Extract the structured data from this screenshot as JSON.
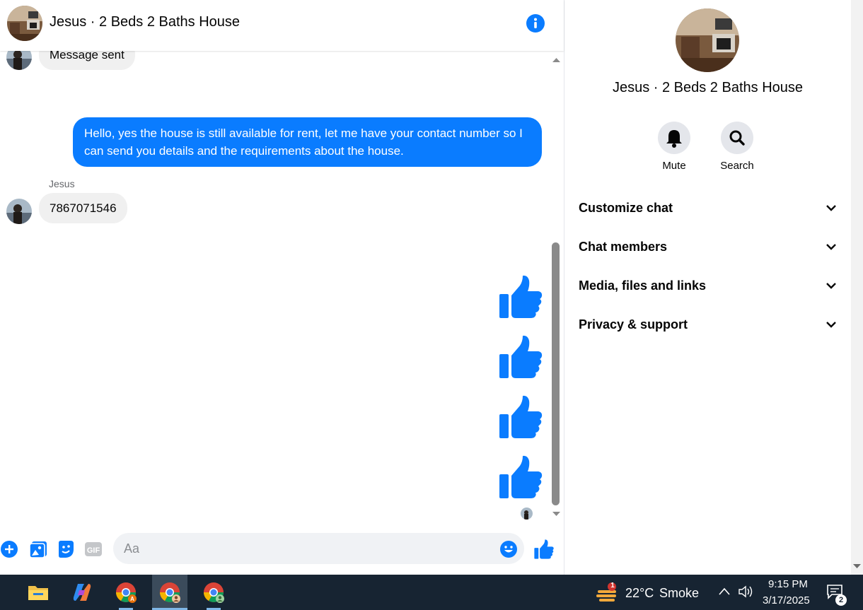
{
  "chat": {
    "title": "Jesus · 2 Beds 2 Baths House",
    "partial_message": "Message sent",
    "outgoing_message": "Hello, yes the house is still available for rent, let me have your contact number so I can send you details and the requirements about the house.",
    "sender_name": "Jesus",
    "incoming_message": "7867071546",
    "like_count": 4
  },
  "composer": {
    "placeholder": "Aa"
  },
  "details": {
    "title": "Jesus · 2 Beds 2 Baths House",
    "actions": [
      {
        "label": "Mute",
        "icon": "bell-icon"
      },
      {
        "label": "Search",
        "icon": "search-icon"
      }
    ],
    "sections": [
      {
        "label": "Customize chat"
      },
      {
        "label": "Chat members"
      },
      {
        "label": "Media, files and links"
      },
      {
        "label": "Privacy & support"
      }
    ]
  },
  "taskbar": {
    "apps": [
      "file-explorer-icon",
      "copilot-icon",
      "chrome-profile-a-icon",
      "chrome-profile-icon",
      "chrome-profile-green-icon"
    ],
    "weather_badge": "1",
    "temperature": "22°C",
    "weather": "Smoke",
    "time": "9:15 PM",
    "date": "3/17/2025",
    "notifications": "2"
  },
  "colors": {
    "accent": "#0a7cff",
    "bubble_in": "#f0f0f0",
    "taskbar": "#172432"
  }
}
